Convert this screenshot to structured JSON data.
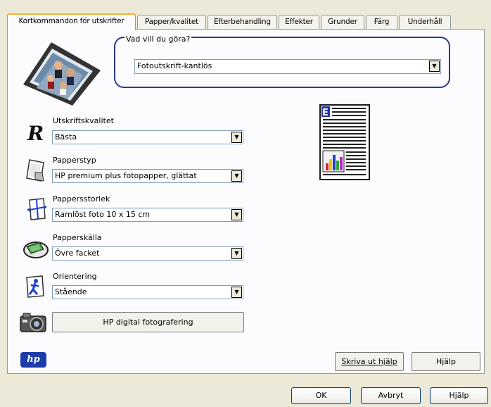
{
  "tabs": [
    {
      "label": "Kortkommandon för utskrifter",
      "active": true
    },
    {
      "label": "Papper/kvalitet",
      "active": false
    },
    {
      "label": "Efterbehandling",
      "active": false
    },
    {
      "label": "Effekter",
      "active": false
    },
    {
      "label": "Grunder",
      "active": false
    },
    {
      "label": "Färg",
      "active": false
    },
    {
      "label": "Underhåll",
      "active": false
    }
  ],
  "task": {
    "legend": "Vad vill du göra?",
    "value": "Fotoutskrift-kantlös"
  },
  "settings": {
    "quality": {
      "label": "Utskriftskvalitet",
      "value": "Bästa"
    },
    "paper_type": {
      "label": "Papperstyp",
      "value": "HP premium plus fotopapper, glättat"
    },
    "paper_size": {
      "label": "Pappersstorlek",
      "value": "Ramlöst foto 10 x 15 cm"
    },
    "paper_source": {
      "label": "Papperskälla",
      "value": "Övre facket"
    },
    "orientation": {
      "label": "Orientering",
      "value": "Stående"
    }
  },
  "digital_photo_button": "HP digital fotografering",
  "print_help_button": "Skriva ut hjälp",
  "help_button": "Hjälp",
  "footer": {
    "ok": "OK",
    "cancel": "Avbryt",
    "help": "Hjälp"
  },
  "logo_text": "hp",
  "preview_letter": "E",
  "colors": {
    "accent_border": "#2e3a8c",
    "tab_highlight": "#f1b33c",
    "dialog_bg": "#ece9d8",
    "panel_bg": "#fcfcfe"
  }
}
